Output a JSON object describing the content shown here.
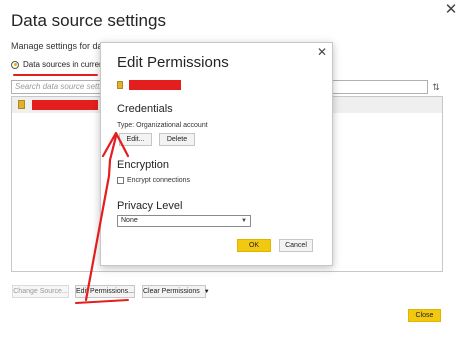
{
  "outer": {
    "title": "Data source settings",
    "close_glyph": "✕",
    "subtitle": "Manage settings for data s",
    "radio_label": "Data sources in current fil",
    "search_placeholder": "Search data source settings",
    "sort_icon": "⇅",
    "buttons": {
      "change_source": "Change Source...",
      "edit_permissions": "Edit Permissions...",
      "clear_permissions": "Clear Permissions",
      "close": "Close"
    }
  },
  "inner": {
    "title": "Edit Permissions",
    "close_glyph": "✕",
    "credentials_heading": "Credentials",
    "credentials_type": "Type: Organizational account",
    "edit_button": "Edit...",
    "delete_button": "Delete",
    "encryption_heading": "Encryption",
    "encrypt_label": "Encrypt connections",
    "privacy_heading": "Privacy Level",
    "privacy_selected": "None",
    "ok_button": "OK",
    "cancel_button": "Cancel"
  },
  "colors": {
    "accent": "#f2c811",
    "annotation": "#e41d1d"
  }
}
